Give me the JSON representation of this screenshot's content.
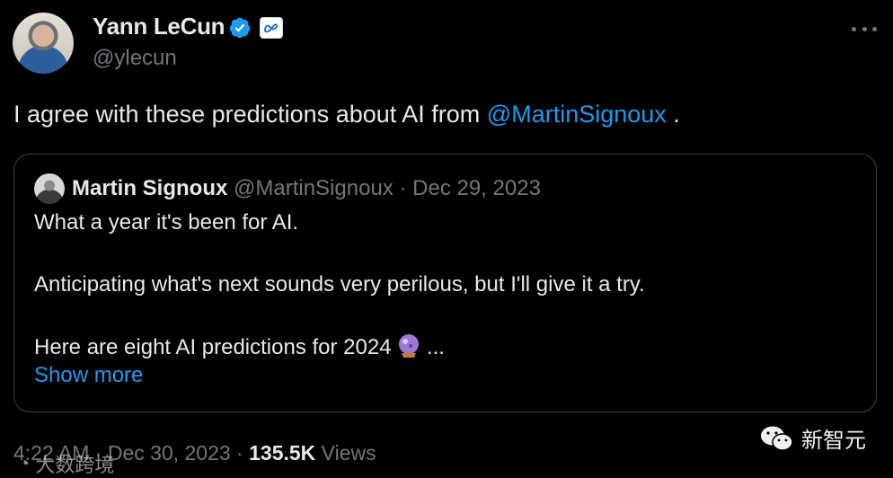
{
  "author": {
    "name": "Yann LeCun",
    "handle": "@ylecun",
    "verified_color": "#1d9bf0",
    "affiliation_icon": "meta-logo-icon"
  },
  "tweet": {
    "text_before": "I agree with these predictions about AI from ",
    "mention": "@MartinSignoux",
    "text_after": " ."
  },
  "quote": {
    "name": "Martin Signoux",
    "handle": "@MartinSignoux",
    "separator": "·",
    "date": "Dec 29, 2023",
    "line1": "What a year it's been for AI.",
    "line2": "Anticipating what's next sounds very perilous, but I'll give it a try.",
    "line3": "Here are eight AI predictions for 2024",
    "line3_suffix": " ...",
    "show_more": "Show more"
  },
  "footer": {
    "time": "4:22 AM",
    "sep1": " · ",
    "date": "Dec 30, 2023",
    "sep2": " · ",
    "views_count": "135.5K",
    "views_label": " Views"
  },
  "watermark": {
    "right_text": "新智元",
    "left_text": "大数跨境"
  },
  "colors": {
    "accent": "#1d9bf0",
    "text": "#e7e9ea",
    "muted": "#71767b",
    "background": "#000000",
    "border": "#3b4046"
  }
}
